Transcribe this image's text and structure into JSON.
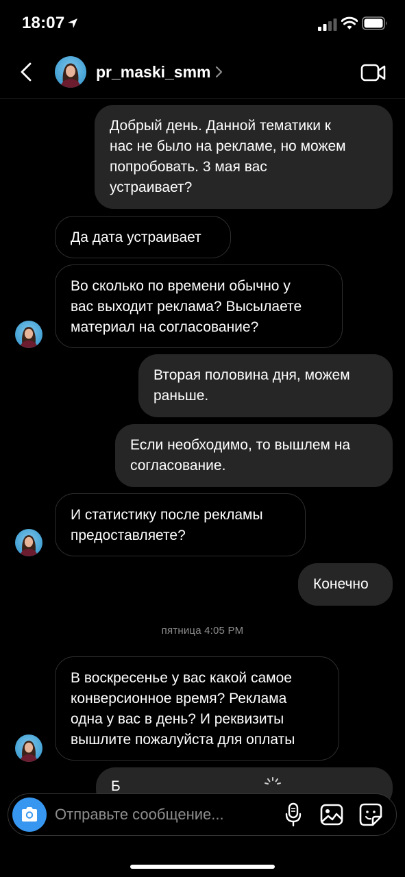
{
  "status_bar": {
    "time": "18:07"
  },
  "header": {
    "username": "pr_maski_smm"
  },
  "messages": [
    {
      "text": "Добрый день. Данной тематики к\nнас не было на рекламе, но можем\nпопробовать. 3 мая вас\nустраивает?"
    },
    {
      "text": "Да дата устраивает"
    },
    {
      "text": "Во сколько по времени  обычно у\nвас выходит реклама? Высылаете\nматериал на согласование?"
    },
    {
      "text": "Вторая половина дня, можем\nраньше."
    },
    {
      "text": "Если необходимо, то вышлем на\nсогласование."
    },
    {
      "text": "И статистику после рекламы\nпредоставляете?"
    },
    {
      "text": "Конечно"
    },
    {
      "text": "В воскресенье у вас какой самое\nконверсионное время? Реклама\nодна у вас в день? И реквизиты\nвышлите пожалуйста для оплаты"
    }
  ],
  "timestamp": "пятница 4:05 PM",
  "partial_message": {
    "text": "Б"
  },
  "composer": {
    "placeholder": "Отправьте сообщение..."
  },
  "icons": {
    "back": "chevron-left-icon",
    "video": "video-camera-icon",
    "camera": "camera-icon",
    "mic": "microphone-icon",
    "gallery": "image-icon",
    "sticker": "sticker-icon"
  },
  "colors": {
    "accent": "#3797f0",
    "outgoing_bubble": "#262626",
    "incoming_border": "#2f2f2f",
    "muted_text": "#8e8e8e"
  }
}
